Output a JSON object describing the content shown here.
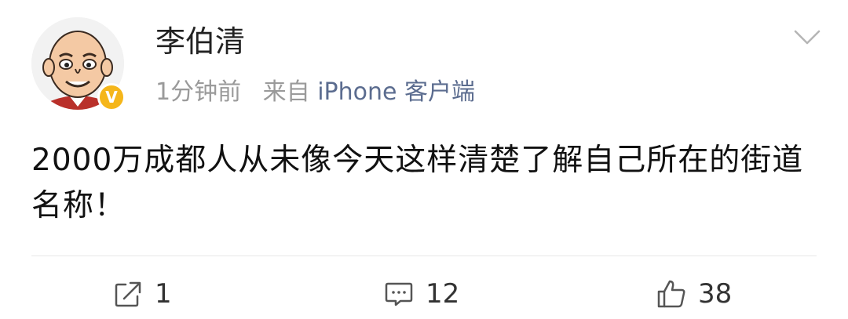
{
  "post": {
    "username": "李伯清",
    "time": "1分钟前",
    "source_prefix": "来自",
    "source": "iPhone 客户端",
    "verified_label": "V",
    "content": "2000万成都人从未像今天这样清楚了解自己所在的街道名称！"
  },
  "actions": {
    "repost_count": "1",
    "comment_count": "12",
    "like_count": "38"
  },
  "icons": {
    "chevron": "chevron-down-icon",
    "repost": "repost-icon",
    "comment": "comment-icon",
    "like": "like-icon"
  },
  "colors": {
    "badge": "#f5b61a",
    "meta_text": "#9a9a9a",
    "source_text": "#5b6c8f",
    "divider": "#e6e6e6"
  }
}
